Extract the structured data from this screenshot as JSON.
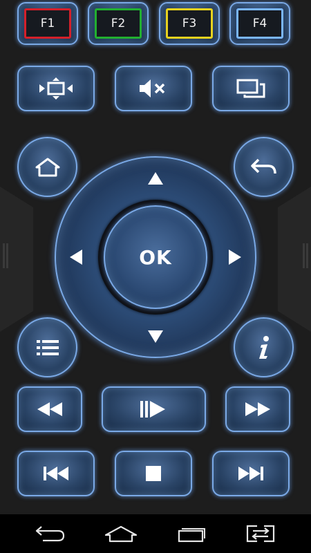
{
  "function_keys": [
    {
      "label": "F1",
      "color": "#d4202a"
    },
    {
      "label": "F2",
      "color": "#22b030"
    },
    {
      "label": "F3",
      "color": "#e8d21e"
    },
    {
      "label": "F4",
      "color": "#7ab6ff"
    }
  ],
  "dpad": {
    "ok_label": "OK"
  },
  "icons": {
    "fullscreen": "fullscreen-icon",
    "mute": "mute-icon",
    "switch_window": "window-switch-icon",
    "home": "home-icon",
    "back": "back-icon",
    "menu": "list-icon",
    "info": "info-icon",
    "rewind": "rewind-icon",
    "play_pause": "play-pause-icon",
    "fast_forward": "fast-forward-icon",
    "previous": "skip-previous-icon",
    "stop": "stop-icon",
    "next": "skip-next-icon"
  },
  "accent_color": "#7aa9e6",
  "system_nav": [
    "back",
    "home",
    "recent-apps",
    "switch-app"
  ]
}
